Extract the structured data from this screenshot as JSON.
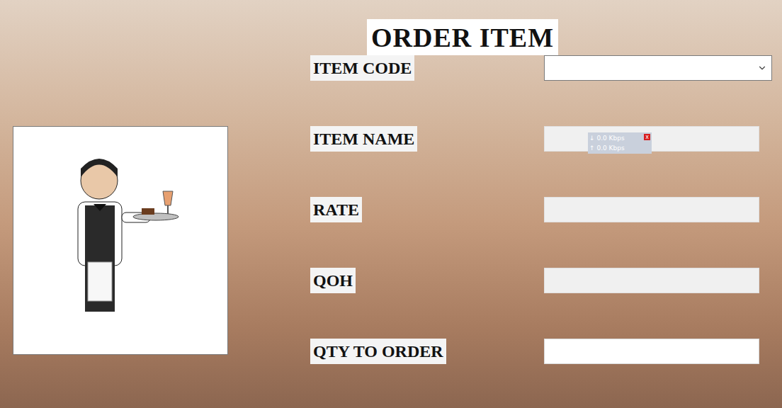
{
  "window": {
    "title": "ORDER ITEM"
  },
  "fields": [
    {
      "label": "ITEM CODE",
      "kind": "select",
      "value": "",
      "disabled": false
    },
    {
      "label": "ITEM NAME",
      "kind": "text",
      "value": "",
      "disabled": true
    },
    {
      "label": "RATE",
      "kind": "text",
      "value": "",
      "disabled": true
    },
    {
      "label": "QOH",
      "kind": "text",
      "value": "",
      "disabled": true
    },
    {
      "label": "QTY TO ORDER",
      "kind": "text",
      "value": "",
      "disabled": false
    }
  ],
  "network_overlay": {
    "download": "↓ 0.0 Kbps",
    "upload": "↑ 0.0 Kbps",
    "close": "x"
  }
}
